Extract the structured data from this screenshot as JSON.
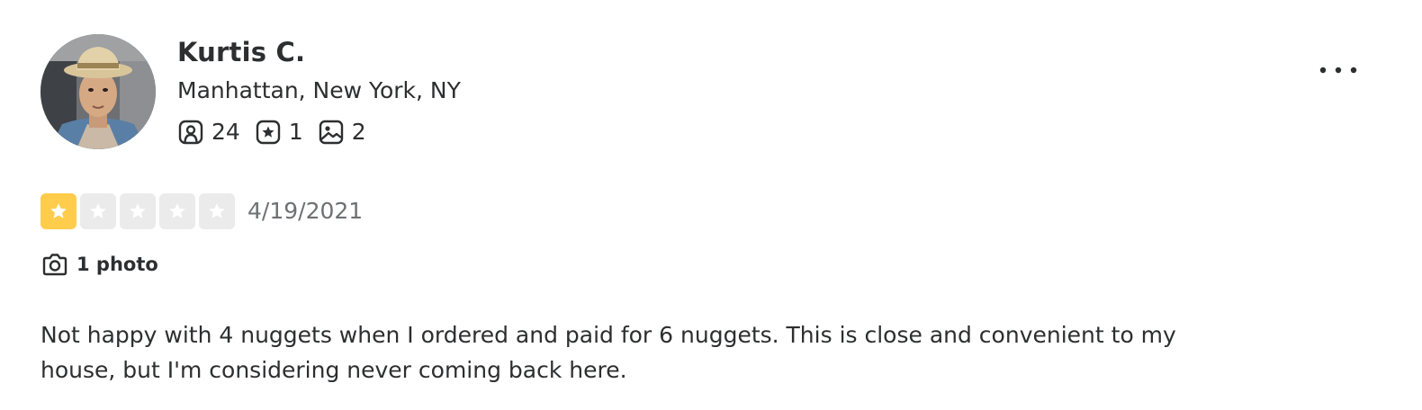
{
  "user": {
    "name": "Kurtis C.",
    "location": "Manhattan, New York, NY",
    "stats": {
      "friends": "24",
      "reviews": "1",
      "photos": "2"
    }
  },
  "review": {
    "rating": 1,
    "max_rating": 5,
    "date": "4/19/2021",
    "photos_label": "1 photo",
    "text": "Not happy with 4 nuggets when I ordered and paid for 6 nuggets. This is close and convenient to my house, but I'm considering never coming back here."
  },
  "icons": {
    "friends": "friends-icon",
    "reviews": "review-star-icon",
    "photos": "photo-icon",
    "more": "more-options-icon",
    "camera": "camera-icon"
  },
  "colors": {
    "star_filled": "#ffcc4b",
    "star_empty": "#ebebeb",
    "text": "#2d2e2f",
    "muted": "#6e7072"
  }
}
